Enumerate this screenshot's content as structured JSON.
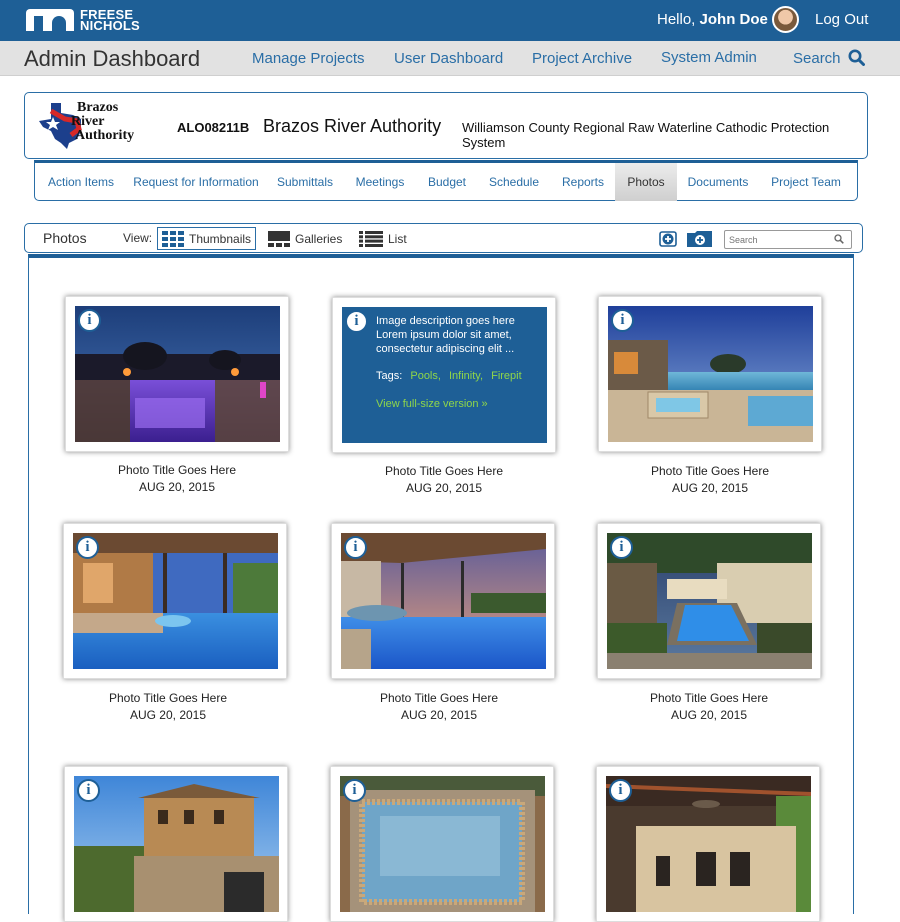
{
  "header": {
    "logo_line1": "FREESE",
    "logo_line2": "NICHOLS",
    "greeting_prefix": "Hello, ",
    "user_name": "John Doe",
    "logout": "Log Out"
  },
  "nav": {
    "title": "Admin Dashboard",
    "links": [
      "Manage Projects",
      "User Dashboard",
      "Project Archive",
      "System Admin",
      "Search"
    ]
  },
  "project": {
    "client_logo_line1": "Brazos",
    "client_logo_line2": "River",
    "client_logo_line3": "Authority",
    "code": "ALO08211B",
    "name": "Brazos River Authority",
    "description": "Williamson County Regional Raw Waterline Cathodic Protection System"
  },
  "tabs": [
    {
      "label": "Action Items",
      "active": false
    },
    {
      "label": "Request for Information",
      "active": false
    },
    {
      "label": "Submittals",
      "active": false
    },
    {
      "label": "Meetings",
      "active": false
    },
    {
      "label": "Budget",
      "active": false
    },
    {
      "label": "Schedule",
      "active": false
    },
    {
      "label": "Reports",
      "active": false
    },
    {
      "label": "Photos",
      "active": true
    },
    {
      "label": "Documents",
      "active": false
    },
    {
      "label": "Project Team",
      "active": false
    }
  ],
  "toolbar": {
    "title": "Photos",
    "view_label": "View:",
    "views": [
      "Thumbnails",
      "Galleries",
      "List"
    ],
    "active_view": "Thumbnails",
    "search_placeholder": "Search"
  },
  "photos": [
    {
      "title": "Photo Title Goes Here",
      "date": "AUG 20, 2015",
      "scene": "night-pool"
    },
    {
      "title": "Photo Title Goes Here",
      "date": "AUG 20, 2015",
      "scene": "description",
      "description": "Image description goes here Lorem ipsum dolor sit amet, consectetur adipiscing elit ...",
      "tags_label": "Tags:",
      "tags": [
        "Pools,",
        "Infinity,",
        "Firepit"
      ],
      "full_link": "View full-size version »"
    },
    {
      "title": "Photo Title Goes Here",
      "date": "AUG 20, 2015",
      "scene": "dusk-pool"
    },
    {
      "title": "Photo Title Goes Here",
      "date": "AUG 20, 2015",
      "scene": "pergola-pool"
    },
    {
      "title": "Photo Title Goes Here",
      "date": "AUG 20, 2015",
      "scene": "sunset-pool"
    },
    {
      "title": "Photo Title Goes Here",
      "date": "AUG 20, 2015",
      "scene": "lap-pool"
    },
    {
      "title": "",
      "date": "",
      "scene": "villa"
    },
    {
      "title": "",
      "date": "",
      "scene": "spa"
    },
    {
      "title": "",
      "date": "",
      "scene": "kitchen"
    }
  ],
  "colors": {
    "brand_blue": "#1e5f96",
    "link_blue": "#2a6ea6",
    "tag_green": "#8fd64a"
  }
}
